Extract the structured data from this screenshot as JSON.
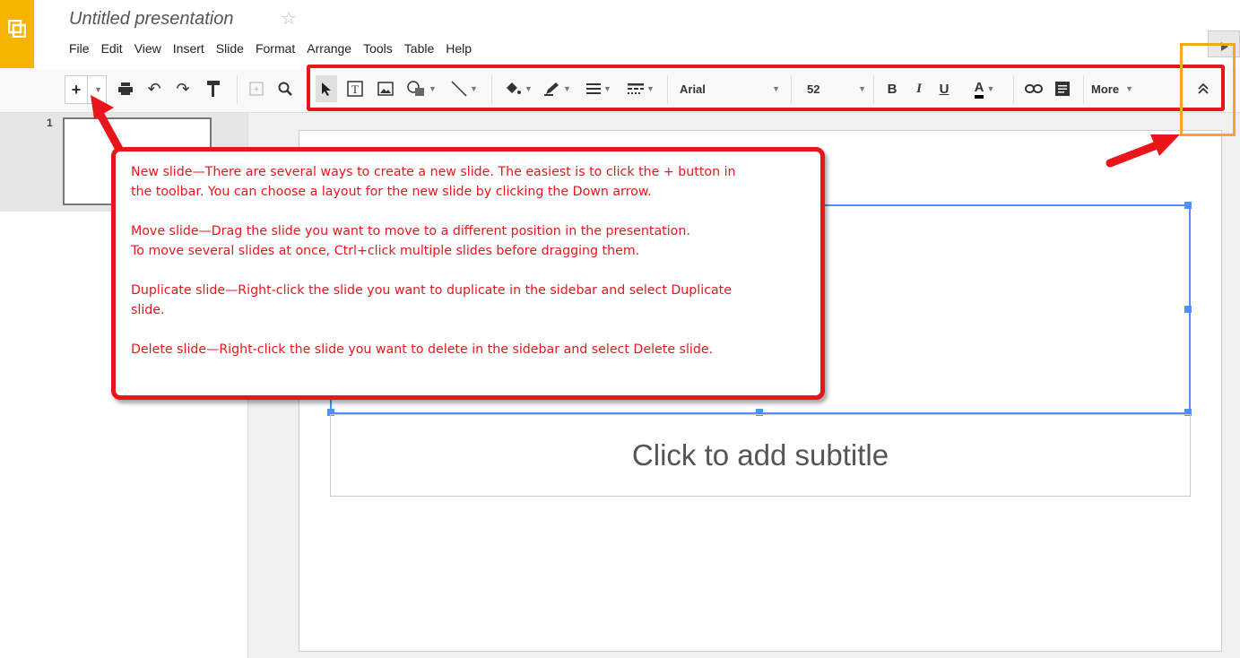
{
  "app": {
    "title": "Untitled presentation",
    "star_glyph": "☆",
    "menu": [
      "File",
      "Edit",
      "View",
      "Insert",
      "Slide",
      "Format",
      "Arrange",
      "Tools",
      "Table",
      "Help"
    ]
  },
  "toolbar": {
    "new_slide": "+",
    "font_name": "Arial",
    "font_size": "52",
    "bold": "B",
    "italic": "I",
    "underline": "U",
    "text_color": "A",
    "more": "More",
    "collapse_glyph": "⌃"
  },
  "sidebar": {
    "slide_numbers": [
      "1"
    ]
  },
  "slide": {
    "subtitle_placeholder": "Click to add subtitle"
  },
  "callout": {
    "new_slide_line1": "New slide—There are several ways to create a new slide. The easiest is to click the + button in",
    "new_slide_line2": "the toolbar. You can choose a layout for the new slide by clicking the Down arrow.",
    "move_slide_line1": "Move slide—Drag the slide you want to move to a different position in the presentation.",
    "move_slide_line2": "To move several slides at once, Ctrl+click multiple slides before dragging them.",
    "duplicate_line1": "Duplicate slide—Right-click the slide you want to duplicate in the sidebar and select Duplicate",
    "duplicate_line2": "slide.",
    "delete_line": "Delete slide—Right-click the slide you want to delete in the sidebar and select Delete slide."
  },
  "colors": {
    "annotation_red": "#e8161b",
    "annotation_orange": "#f6a623",
    "selection_blue": "#4d90fe",
    "logo_yellow": "#f4b400"
  }
}
